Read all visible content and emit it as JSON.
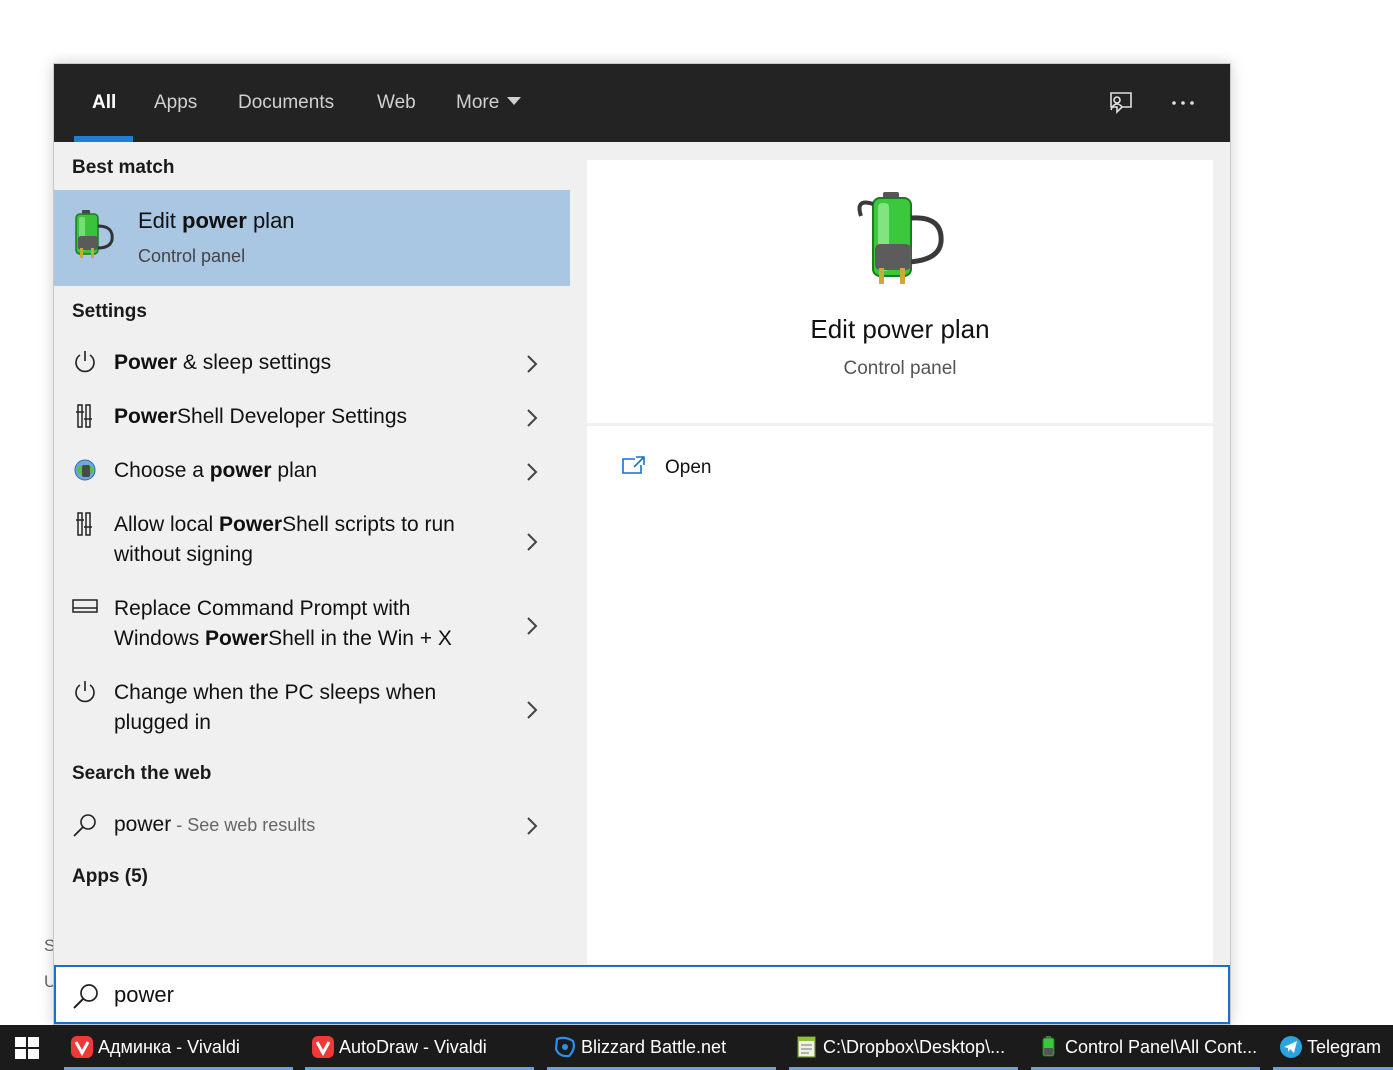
{
  "background": {
    "line1": "S",
    "line2": "U"
  },
  "tabs": [
    {
      "label": "All"
    },
    {
      "label": "Apps"
    },
    {
      "label": "Documents"
    },
    {
      "label": "Web"
    },
    {
      "label": "More"
    }
  ],
  "top_icons": [
    "feedback-icon",
    "more-options-icon"
  ],
  "best_match": {
    "heading": "Best match",
    "title_pre": "Edit ",
    "title_bold": "power",
    "title_post": " plan",
    "subtitle": "Control panel",
    "icon": "power-plan-battery-icon"
  },
  "settings": {
    "heading": "Settings",
    "items": [
      {
        "icon": "power-icon",
        "line1_pre": "",
        "line1_bold": "Power",
        "line1_post": " & sleep settings",
        "line2": ""
      },
      {
        "icon": "developer-tools-icon",
        "line1_pre": "",
        "line1_bold": "Power",
        "line1_post": "Shell Developer Settings",
        "line2": ""
      },
      {
        "icon": "power-options-icon",
        "line1_pre": "Choose a ",
        "line1_bold": "power",
        "line1_post": " plan",
        "line2": ""
      },
      {
        "icon": "developer-tools-icon",
        "line1_pre": "Allow local ",
        "line1_bold": "Power",
        "line1_post": "Shell scripts to run",
        "line2": "without signing"
      },
      {
        "icon": "taskbar-icon",
        "line1_pre": "Replace Command Prompt with",
        "line1_bold": "",
        "line1_post": "",
        "line2_pre": "Windows ",
        "line2_bold": "Power",
        "line2_post": "Shell in the Win + X"
      },
      {
        "icon": "power-icon",
        "line1_pre": "Change when the PC sleeps when",
        "line1_bold": "",
        "line1_post": "",
        "line2": "plugged in"
      }
    ]
  },
  "web": {
    "heading": "Search the web",
    "query": "power",
    "suffix": " - See web results"
  },
  "apps": {
    "heading": "Apps (5)"
  },
  "preview": {
    "title": "Edit power plan",
    "subtitle": "Control panel",
    "open_label": "Open"
  },
  "search": {
    "value": "power",
    "placeholder": ""
  },
  "taskbar": {
    "items": [
      {
        "label": "Админка - Vivaldi",
        "icon": "vivaldi-icon"
      },
      {
        "label": "AutoDraw - Vivaldi",
        "icon": "vivaldi-icon"
      },
      {
        "label": "Blizzard Battle.net",
        "icon": "battlenet-icon"
      },
      {
        "label": "C:\\Dropbox\\Desktop\\...",
        "icon": "notepad-icon"
      },
      {
        "label": "Control Panel\\All Cont...",
        "icon": "power-plan-battery-icon"
      },
      {
        "label": "Telegram",
        "icon": "telegram-icon"
      }
    ]
  },
  "colors": {
    "accent": "#1f7fd6",
    "selected": "#a9c7e2",
    "topbar": "#232323",
    "taskbar": "#1b1b1b"
  }
}
